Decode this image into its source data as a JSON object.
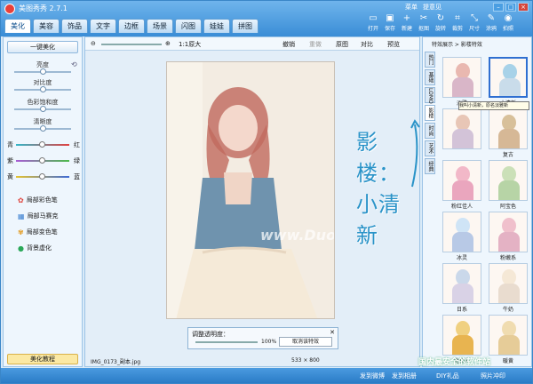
{
  "app": {
    "title": "美图秀秀 2.7.1",
    "top_links": [
      "菜单",
      "提意见"
    ],
    "win_controls": [
      "–",
      "□",
      "×"
    ]
  },
  "tabs": [
    "美化",
    "美容",
    "饰品",
    "文字",
    "边框",
    "场景",
    "闪图",
    "娃娃",
    "拼图"
  ],
  "toolbar": [
    {
      "label": "打开",
      "icon": "open-icon"
    },
    {
      "label": "保存",
      "icon": "save-icon"
    },
    {
      "label": "新建",
      "icon": "new-icon"
    },
    {
      "label": "抠图",
      "icon": "cutout-icon"
    },
    {
      "label": "旋转",
      "icon": "rotate-icon"
    },
    {
      "label": "裁剪",
      "icon": "crop-icon"
    },
    {
      "label": "尺寸",
      "icon": "resize-icon"
    },
    {
      "label": "涂鸦",
      "icon": "doodle-icon"
    },
    {
      "label": "拍照",
      "icon": "camera-icon"
    }
  ],
  "left": {
    "oneclick": "一键美化",
    "adjust": [
      "亮度",
      "对比度",
      "色彩饱和度",
      "清晰度"
    ],
    "color_balance": [
      {
        "l": "青",
        "r": "红",
        "c1": "#32b6c8",
        "c2": "#e24040"
      },
      {
        "l": "紫",
        "r": "绿",
        "c1": "#a85bd6",
        "c2": "#4bbb4a"
      },
      {
        "l": "黄",
        "r": "蓝",
        "c1": "#e6c32e",
        "c2": "#3c69d6"
      }
    ],
    "tools": [
      "局部彩色笔",
      "局部马赛克",
      "局部变色笔",
      "背景虚化"
    ],
    "tutorial": "美化教程"
  },
  "center": {
    "zoom": "1:1原大",
    "actions": [
      "撤销",
      "重做",
      "原图",
      "对比",
      "预览"
    ],
    "overlay_text": "影楼：小清新",
    "watermark": "www.DuoTe.com",
    "opacity_panel": {
      "title": "调整透明度：",
      "pct": "100%",
      "button": "取消该特效"
    },
    "filename": "IMG_0173_副本.jpg",
    "dims": "533 × 800"
  },
  "right": {
    "breadcrumb": "特效展示 > 影楼特效",
    "vtabs": [
      "热门",
      "基础",
      "LOMO",
      "影楼",
      "时尚",
      "艺术",
      "经典"
    ],
    "tooltip": "我叫小清新，原名淡雅新",
    "thumbs": [
      {
        "label": "淡雅",
        "face": "#e9b8b0",
        "body": "#d9b6c8"
      },
      {
        "label": "小清新",
        "face": "#a8d2e8",
        "body": "#c9dcea",
        "selected": true
      },
      {
        "label": "",
        "face": "#e8c6b6",
        "body": "#d3c3d8"
      },
      {
        "label": "复古",
        "face": "#d8c09a",
        "body": "#d6b896"
      },
      {
        "label": "粉红佳人",
        "face": "#f2b8c8",
        "body": "#eaa6be"
      },
      {
        "label": "阿宝色",
        "face": "#cbe0b8",
        "body": "#b7d4a6"
      },
      {
        "label": "冰灵",
        "face": "#cfe4f6",
        "body": "#b8c9e6"
      },
      {
        "label": "粉嫩系",
        "face": "#f0c0cc",
        "body": "#e4b2c4"
      },
      {
        "label": "日系",
        "face": "#cad8ea",
        "body": "#d9d2e6"
      },
      {
        "label": "牛奶",
        "face": "#f5e8d6",
        "body": "#e9dccf"
      },
      {
        "label": "北极光",
        "face": "#f0d080",
        "body": "#e8b450"
      },
      {
        "label": "暖黄",
        "face": "#f0dcb0",
        "body": "#e6cc98"
      }
    ]
  },
  "status": {
    "items": [
      "发到微博",
      "发到相册",
      "DIY礼品",
      "照片冲印"
    ],
    "site": "国内最安全的软件站"
  }
}
